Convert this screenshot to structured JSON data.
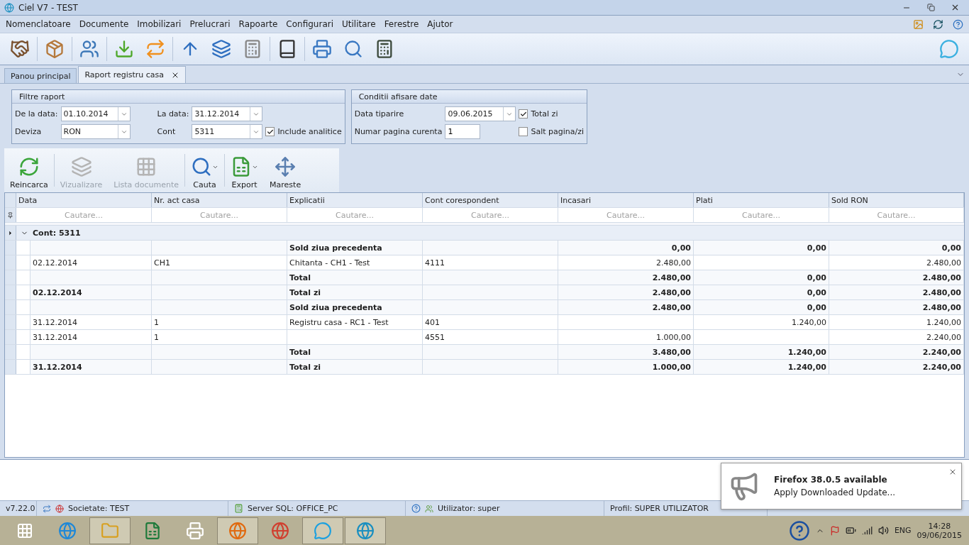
{
  "window": {
    "title": "Ciel V7 - TEST"
  },
  "menu": [
    "Nomenclatoare",
    "Documente",
    "Imobilizari",
    "Prelucrari",
    "Rapoarte",
    "Configurari",
    "Utilitare",
    "Ferestre",
    "Ajutor"
  ],
  "tabs": [
    {
      "label": "Panou principal",
      "selected": false,
      "closable": false
    },
    {
      "label": "Raport registru casa",
      "selected": true,
      "closable": true
    }
  ],
  "filters": {
    "title": "Filtre raport",
    "fields": [
      {
        "label": "De la data:",
        "value": "01.10.2014"
      },
      {
        "label": "La data:",
        "value": "31.12.2014"
      },
      {
        "label": "Deviza",
        "value": "RON"
      },
      {
        "label": "Cont",
        "value": "5311"
      }
    ],
    "checkbox": {
      "label": "Include analitice",
      "checked": true
    }
  },
  "display": {
    "title": "Conditii afisare date",
    "print_date": {
      "label": "Data tiparire",
      "value": "09.06.2015"
    },
    "page": {
      "label": "Numar pagina curenta",
      "value": "1"
    },
    "checkboxes": [
      {
        "label": "Total zi",
        "checked": true
      },
      {
        "label": "Salt pagina/zi",
        "checked": false
      }
    ]
  },
  "actions": [
    {
      "label": "Reincarca",
      "disabled": false,
      "dropdown": false
    },
    {
      "label": "Vizualizare",
      "disabled": true,
      "dropdown": false
    },
    {
      "label": "Lista documente",
      "disabled": true,
      "dropdown": false
    },
    {
      "label": "Cauta",
      "disabled": false,
      "dropdown": true
    },
    {
      "label": "Export",
      "disabled": false,
      "dropdown": true
    },
    {
      "label": "Mareste",
      "disabled": false,
      "dropdown": false
    }
  ],
  "table": {
    "columns": [
      "Data",
      "Nr. act casa",
      "Explicatii",
      "Cont corespondent",
      "Incasari",
      "Plati",
      "Sold RON"
    ],
    "search_placeholders": [
      "Cautare...",
      "Cautare...",
      "Cautare...",
      "Cautare...",
      "Cautare...",
      "Cautare...",
      "Cautare..."
    ],
    "group": {
      "label": "Cont: 5311",
      "expanded": true
    },
    "rows": [
      {
        "kind": "summary",
        "cells": [
          "",
          "",
          "Sold ziua precedenta",
          "",
          "0,00",
          "0,00",
          "0,00"
        ]
      },
      {
        "kind": "entry",
        "cells": [
          "02.12.2014",
          "CH1",
          "Chitanta - CH1 - Test",
          "4111",
          "2.480,00",
          "",
          "2.480,00"
        ]
      },
      {
        "kind": "summary",
        "cells": [
          "",
          "",
          "Total",
          "",
          "2.480,00",
          "0,00",
          "2.480,00"
        ]
      },
      {
        "kind": "summary",
        "cells": [
          "02.12.2014",
          "",
          "Total zi",
          "",
          "2.480,00",
          "0,00",
          "2.480,00"
        ]
      },
      {
        "kind": "summary",
        "cells": [
          "",
          "",
          "Sold ziua precedenta",
          "",
          "2.480,00",
          "0,00",
          "2.480,00"
        ]
      },
      {
        "kind": "entry",
        "cells": [
          "31.12.2014",
          "1",
          "Registru casa - RC1 - Test",
          "401",
          "",
          "1.240,00",
          "1.240,00"
        ]
      },
      {
        "kind": "entry",
        "cells": [
          "31.12.2014",
          "1",
          "",
          "4551",
          "1.000,00",
          "",
          "2.240,00"
        ]
      },
      {
        "kind": "summary",
        "cells": [
          "",
          "",
          "Total",
          "",
          "3.480,00",
          "1.240,00",
          "2.240,00"
        ]
      },
      {
        "kind": "summary",
        "cells": [
          "31.12.2014",
          "",
          "Total zi",
          "",
          "1.000,00",
          "1.240,00",
          "2.240,00"
        ]
      }
    ]
  },
  "status_bar": {
    "version": "v7.22.0",
    "company": "Societate: TEST",
    "server": "Server SQL: OFFICE_PC",
    "user": "Utilizator: super",
    "profile": "Profil: SUPER UTILIZATOR"
  },
  "notification": {
    "title": "Firefox 38.0.5 available",
    "message": "Apply Downloaded Update..."
  },
  "taskbar": {
    "language": "ENG",
    "time": "14:28",
    "date": "09/06/2015"
  }
}
